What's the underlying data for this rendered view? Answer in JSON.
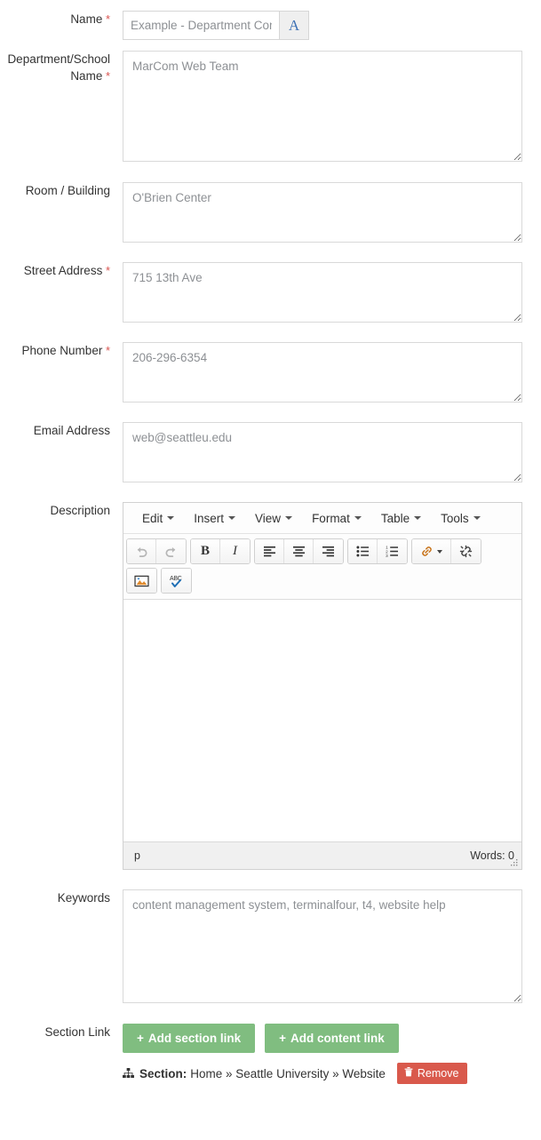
{
  "fields": {
    "name": {
      "label": "Name",
      "required": true,
      "placeholder": "Example - Department Contact",
      "value": "",
      "format_button": "A"
    },
    "department": {
      "label_line1": "Department/School",
      "label_line2": "Name",
      "required": true,
      "placeholder": "MarCom Web Team",
      "value": ""
    },
    "room": {
      "label": "Room / Building",
      "required": false,
      "placeholder": "O'Brien Center",
      "value": ""
    },
    "street": {
      "label": "Street Address",
      "required": true,
      "placeholder": "715 13th Ave",
      "value": ""
    },
    "phone": {
      "label": "Phone Number",
      "required": true,
      "placeholder": "206-296-6354",
      "value": ""
    },
    "email": {
      "label": "Email Address",
      "required": false,
      "placeholder": "web@seattleu.edu",
      "value": ""
    },
    "description": {
      "label": "Description",
      "required": false
    },
    "keywords": {
      "label": "Keywords",
      "required": false,
      "placeholder": "content management system, terminalfour, t4, website help",
      "value": ""
    },
    "section_link": {
      "label": "Section Link"
    }
  },
  "editor": {
    "menus": [
      {
        "label": "Edit"
      },
      {
        "label": "Insert"
      },
      {
        "label": "View"
      },
      {
        "label": "Format"
      },
      {
        "label": "Table"
      },
      {
        "label": "Tools"
      }
    ],
    "toolbar_groups": [
      {
        "buttons": [
          {
            "name": "undo-icon",
            "glyph": "↶",
            "disabled": true
          },
          {
            "name": "redo-icon",
            "glyph": "↷",
            "disabled": true
          }
        ]
      },
      {
        "buttons": [
          {
            "name": "bold-icon",
            "glyph": "B",
            "disabled": false
          },
          {
            "name": "italic-icon",
            "glyph": "I",
            "disabled": false
          }
        ]
      },
      {
        "buttons": [
          {
            "name": "align-left-icon",
            "glyph": "",
            "disabled": false
          },
          {
            "name": "align-center-icon",
            "glyph": "",
            "disabled": false
          },
          {
            "name": "align-right-icon",
            "glyph": "",
            "disabled": false
          }
        ]
      },
      {
        "buttons": [
          {
            "name": "bullet-list-icon",
            "glyph": "",
            "disabled": false
          },
          {
            "name": "numbered-list-icon",
            "glyph": "",
            "disabled": false
          }
        ]
      },
      {
        "buttons": [
          {
            "name": "insert-link-icon",
            "glyph": "",
            "disabled": false
          },
          {
            "name": "unlink-icon",
            "glyph": "",
            "disabled": false
          }
        ]
      },
      {
        "buttons": [
          {
            "name": "insert-image-icon",
            "glyph": "",
            "disabled": false
          }
        ]
      },
      {
        "buttons": [
          {
            "name": "spellcheck-icon",
            "glyph": "ABC",
            "disabled": false
          }
        ]
      }
    ],
    "content": "",
    "status": {
      "path": "p",
      "word_count": "Words: 0"
    }
  },
  "section_link": {
    "add_section_label": "Add section link",
    "add_content_label": "Add content link",
    "plus": "+",
    "section_prefix": "Section:",
    "section_path": "Home » Seattle University » Website",
    "remove_label": "Remove"
  },
  "colors": {
    "green_button": "#80bd80",
    "remove_button": "#d9594c",
    "required_asterisk": "#d9534f",
    "accent_blue": "#3f72b5"
  }
}
